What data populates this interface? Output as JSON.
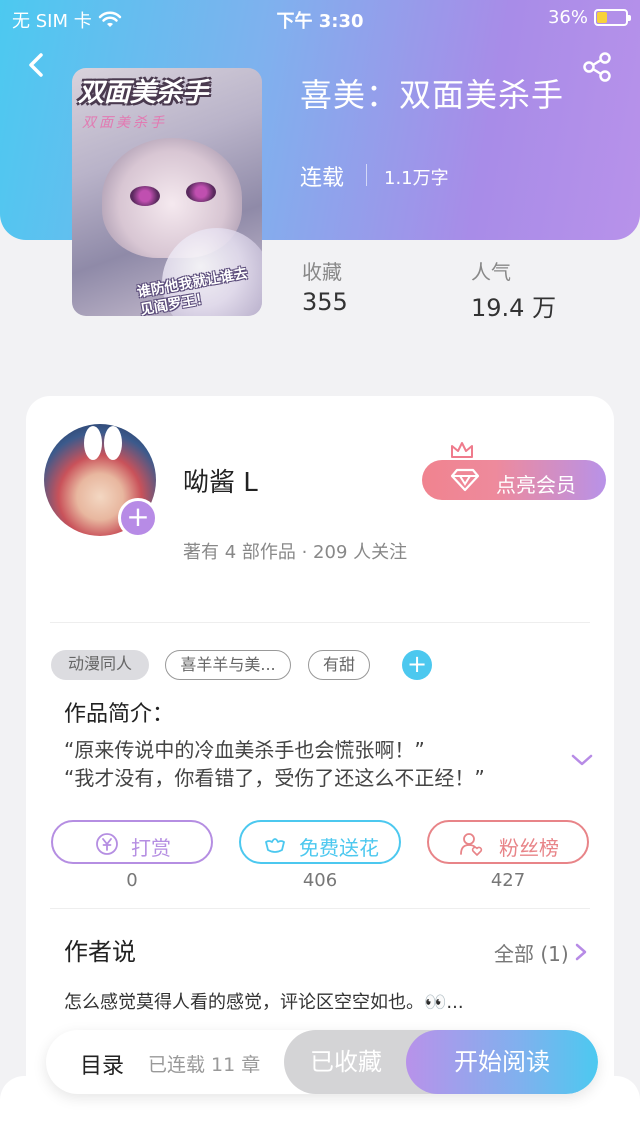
{
  "status_bar": {
    "carrier": "无 SIM 卡",
    "time": "下午 3:30",
    "battery_pct": "36%",
    "battery_level": 0.36
  },
  "book": {
    "cover_title": "双面美杀手",
    "cover_subtitle": "双面美杀手",
    "cover_quote": "谁防他我就让谁去\n见阎罗王！",
    "title": "喜美：双面美杀手",
    "status": "连载",
    "word_count": "1.1万字",
    "favorites_label": "收藏",
    "favorites_value": "355",
    "popularity_label": "人气",
    "popularity_value": "19.4 万"
  },
  "author": {
    "name": "呦酱 L",
    "meta": "著有 4 部作品 · 209 人关注",
    "vip_label": "点亮会员"
  },
  "tags": [
    {
      "label": "动漫同人",
      "style": "filled"
    },
    {
      "label": "喜羊羊与美...",
      "style": "outline"
    },
    {
      "label": "有甜",
      "style": "outline"
    }
  ],
  "intro": {
    "title": "作品简介：",
    "line1": "“原来传说中的冷血美杀手也会慌张啊！”",
    "line2": "“我才没有，你看错了，受伤了还这么不正经！”"
  },
  "actions": [
    {
      "label": "打赏",
      "count": "0",
      "color": "#b58ee2",
      "icon": "coin-icon"
    },
    {
      "label": "免费送花",
      "count": "406",
      "color": "#4cc8ef",
      "icon": "flower-icon"
    },
    {
      "label": "粉丝榜",
      "count": "427",
      "color": "#e88488",
      "icon": "fan-rank-icon"
    }
  ],
  "author_says": {
    "title": "作者说",
    "all_label": "全部 (1)",
    "comment": "怎么感觉莫得人看的感觉，评论区空空如也。👀..."
  },
  "bottom_bar": {
    "toc_label": "目录",
    "toc_count": "已连载 11 章",
    "collected_label": "已收藏",
    "read_label": "开始阅读"
  },
  "colors": {
    "header_gradient_start": "#4cc9f0",
    "header_gradient_end": "#b892ea",
    "accent_purple": "#b78be6",
    "accent_blue": "#4cc8ef",
    "accent_pink": "#e88488"
  }
}
